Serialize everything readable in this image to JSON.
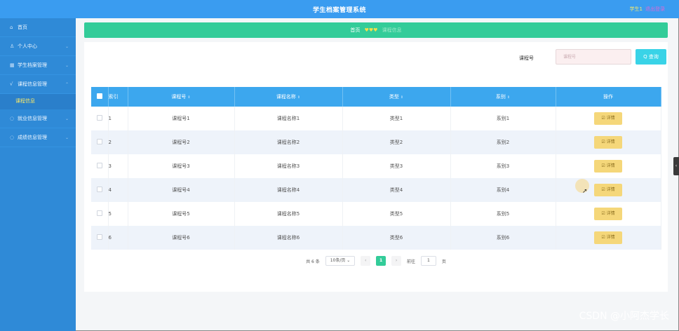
{
  "header": {
    "title": "学生档案管理系统",
    "user": "学生1",
    "logout": "退出登录"
  },
  "sidebar": {
    "items": [
      {
        "label": "首页",
        "icon": "home-icon",
        "glyph": "⌂"
      },
      {
        "label": "个人中心",
        "icon": "user-icon",
        "glyph": "♙",
        "arrow": "⌄"
      },
      {
        "label": "学生档案管理",
        "icon": "grid-icon",
        "glyph": "▦",
        "arrow": "⌄"
      },
      {
        "label": "课程信息管理",
        "icon": "check-icon",
        "glyph": "√",
        "arrow": "⌃"
      },
      {
        "label": "就业信息管理",
        "icon": "circle-icon",
        "glyph": "◌",
        "arrow": "⌄"
      },
      {
        "label": "成绩信息管理",
        "icon": "circle-icon",
        "glyph": "◌",
        "arrow": "⌄"
      }
    ],
    "sub_item": "课程信息"
  },
  "breadcrumb": {
    "home": "首页",
    "separator": "♥♥♥",
    "current": "课程信息"
  },
  "search": {
    "label": "课程号",
    "placeholder": "课程号",
    "button": "Q 查询"
  },
  "table": {
    "headers": [
      "索引",
      "课程号",
      "课程名称",
      "类型",
      "系别",
      "操作"
    ],
    "sort_glyph": "⇕",
    "rows": [
      {
        "index": "1",
        "course_no": "课程号1",
        "course_name": "课程名称1",
        "type": "类型1",
        "dept": "系别1",
        "action": "☑ 详情"
      },
      {
        "index": "2",
        "course_no": "课程号2",
        "course_name": "课程名称2",
        "type": "类型2",
        "dept": "系别2",
        "action": "☑ 详情"
      },
      {
        "index": "3",
        "course_no": "课程号3",
        "course_name": "课程名称3",
        "type": "类型3",
        "dept": "系别3",
        "action": "☑ 详情"
      },
      {
        "index": "4",
        "course_no": "课程号4",
        "course_name": "课程名称4",
        "type": "类型4",
        "dept": "系别4",
        "action": "☑ 详情"
      },
      {
        "index": "5",
        "course_no": "课程号5",
        "course_name": "课程名称5",
        "type": "类型5",
        "dept": "系别5",
        "action": "☑ 详情"
      },
      {
        "index": "6",
        "course_no": "课程号6",
        "course_name": "课程名称6",
        "type": "类型6",
        "dept": "系别6",
        "action": "☑ 详情"
      }
    ]
  },
  "pagination": {
    "total": "共 6 条",
    "page_size": "10条/页 ⌄",
    "prev": "‹",
    "current": "1",
    "next": "›",
    "goto_label": "前往",
    "goto_value": "1",
    "page_unit": "页"
  },
  "side_tab": "‹",
  "watermark": "CSDN @小阿杰学长",
  "colors": {
    "header": "#3a9cf0",
    "sidebar": "#2f8ad7",
    "breadcrumb": "#33cc99",
    "table_header": "#3ca7ee",
    "detail_button": "#f5d77a",
    "search_button": "#39d3e7"
  }
}
